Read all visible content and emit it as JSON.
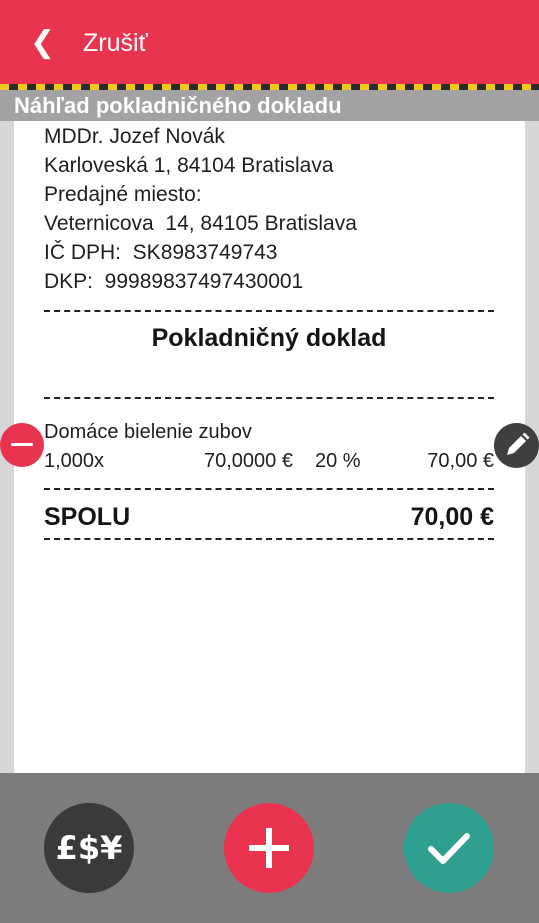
{
  "header": {
    "cancel_label": "Zrušiť",
    "back_icon": "chevron-left-icon"
  },
  "preview": {
    "title": "Náhľad pokladničného dokladu"
  },
  "receipt": {
    "lines": [
      "MDDr. Jozef Novák",
      "Karloveská 1, 84104 Bratislava",
      "Predajné miesto:",
      "Veternicova  14, 84105 Bratislava",
      "IČ DPH:  SK8983749743",
      "DKP:  99989837497430001"
    ],
    "title": "Pokladničný doklad",
    "item": {
      "name": "Domáce bielenie zubov",
      "quantity": "1,000x",
      "unit_price": "70,0000 €",
      "vat": "20 %",
      "amount": "70,00 €"
    },
    "total_label": "SPOLU",
    "total_value": "70,00 €"
  },
  "actions": {
    "currency_label": "£$¥",
    "remove_icon": "minus-circle-icon",
    "edit_icon": "pencil-icon",
    "add_icon": "plus-icon",
    "confirm_icon": "checkmark-icon"
  },
  "colors": {
    "primary": "#e8344e",
    "teal": "#2f9f8f",
    "dark": "#3a3a3a"
  }
}
